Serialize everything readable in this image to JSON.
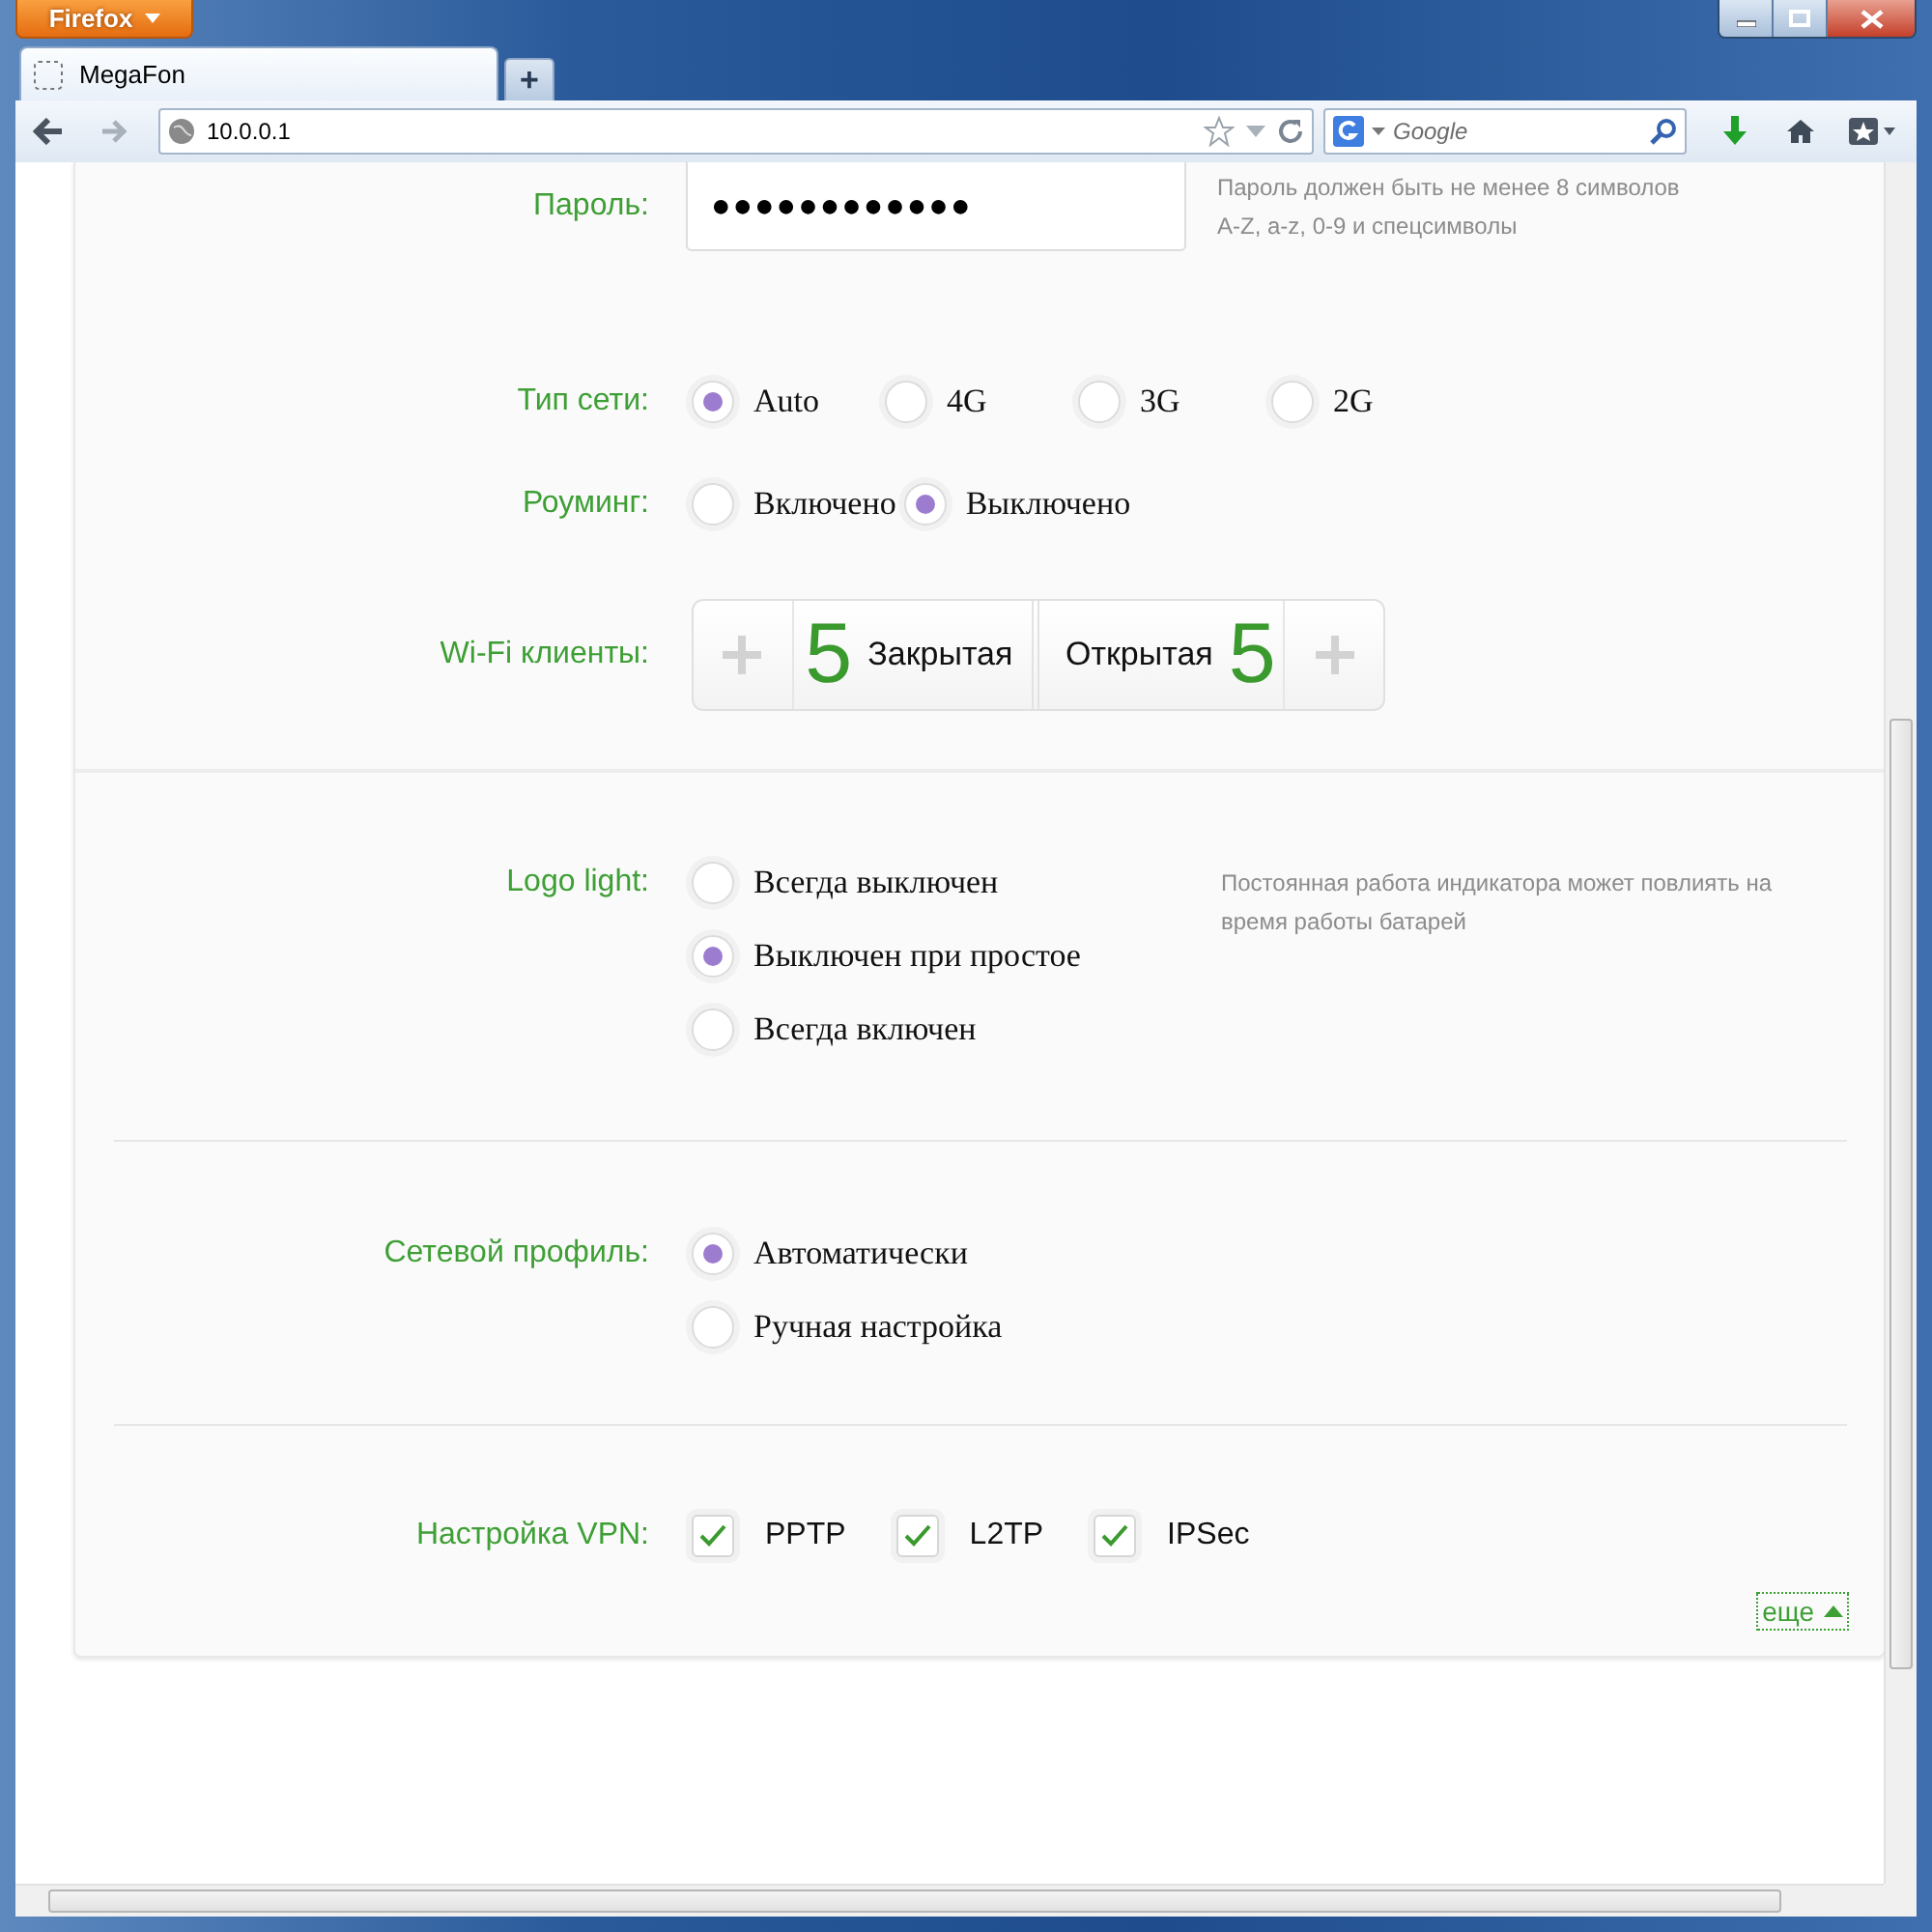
{
  "browser": {
    "menu_button": "Firefox",
    "tab": {
      "title": "MegaFon"
    },
    "new_tab_button": "+",
    "address": "10.0.0.1",
    "search": {
      "placeholder": "Google"
    }
  },
  "sections": [
    {
      "rows": [
        {
          "kind": "password",
          "label": "Пароль:",
          "value": "●●●●●●●●●●●●",
          "hint": [
            "Пароль должен быть не менее 8 символов",
            "A-Z, a-z, 0-9 и спецсимволы"
          ]
        },
        {
          "kind": "radio",
          "label": "Тип сети:",
          "options": [
            {
              "label": "Auto",
              "selected": true
            },
            {
              "label": "4G",
              "selected": false
            },
            {
              "label": "3G",
              "selected": false
            },
            {
              "label": "2G",
              "selected": false
            }
          ]
        },
        {
          "kind": "radio",
          "label": "Роуминг:",
          "options": [
            {
              "label": "Включено",
              "selected": false
            },
            {
              "label": "Выключено",
              "selected": true
            }
          ]
        },
        {
          "kind": "wifi",
          "label": "Wi-Fi клиенты:",
          "closed": {
            "count": "5",
            "label": "Закрытая"
          },
          "open": {
            "label": "Открытая",
            "count": "5"
          }
        }
      ]
    },
    {
      "rows": [
        {
          "kind": "radio-list",
          "label": "Logo light:",
          "options": [
            {
              "label": "Всегда выключен",
              "selected": false
            },
            {
              "label": "Выключен при простое",
              "selected": true
            },
            {
              "label": "Всегда включен",
              "selected": false
            }
          ],
          "hint": [
            "Постоянная работа индикатора может повлиять на",
            "время работы батарей"
          ]
        }
      ]
    },
    {
      "rows": [
        {
          "kind": "radio-list",
          "label": "Сетевой профиль:",
          "options": [
            {
              "label": "Автоматически",
              "selected": true
            },
            {
              "label": "Ручная настройка",
              "selected": false
            }
          ]
        }
      ]
    },
    {
      "rows": [
        {
          "kind": "checkbox",
          "label": "Настройка VPN:",
          "options": [
            {
              "label": "PPTP",
              "checked": true
            },
            {
              "label": "L2TP",
              "checked": true
            },
            {
              "label": "IPSec",
              "checked": true
            }
          ]
        }
      ],
      "more_link": "еще"
    }
  ]
}
